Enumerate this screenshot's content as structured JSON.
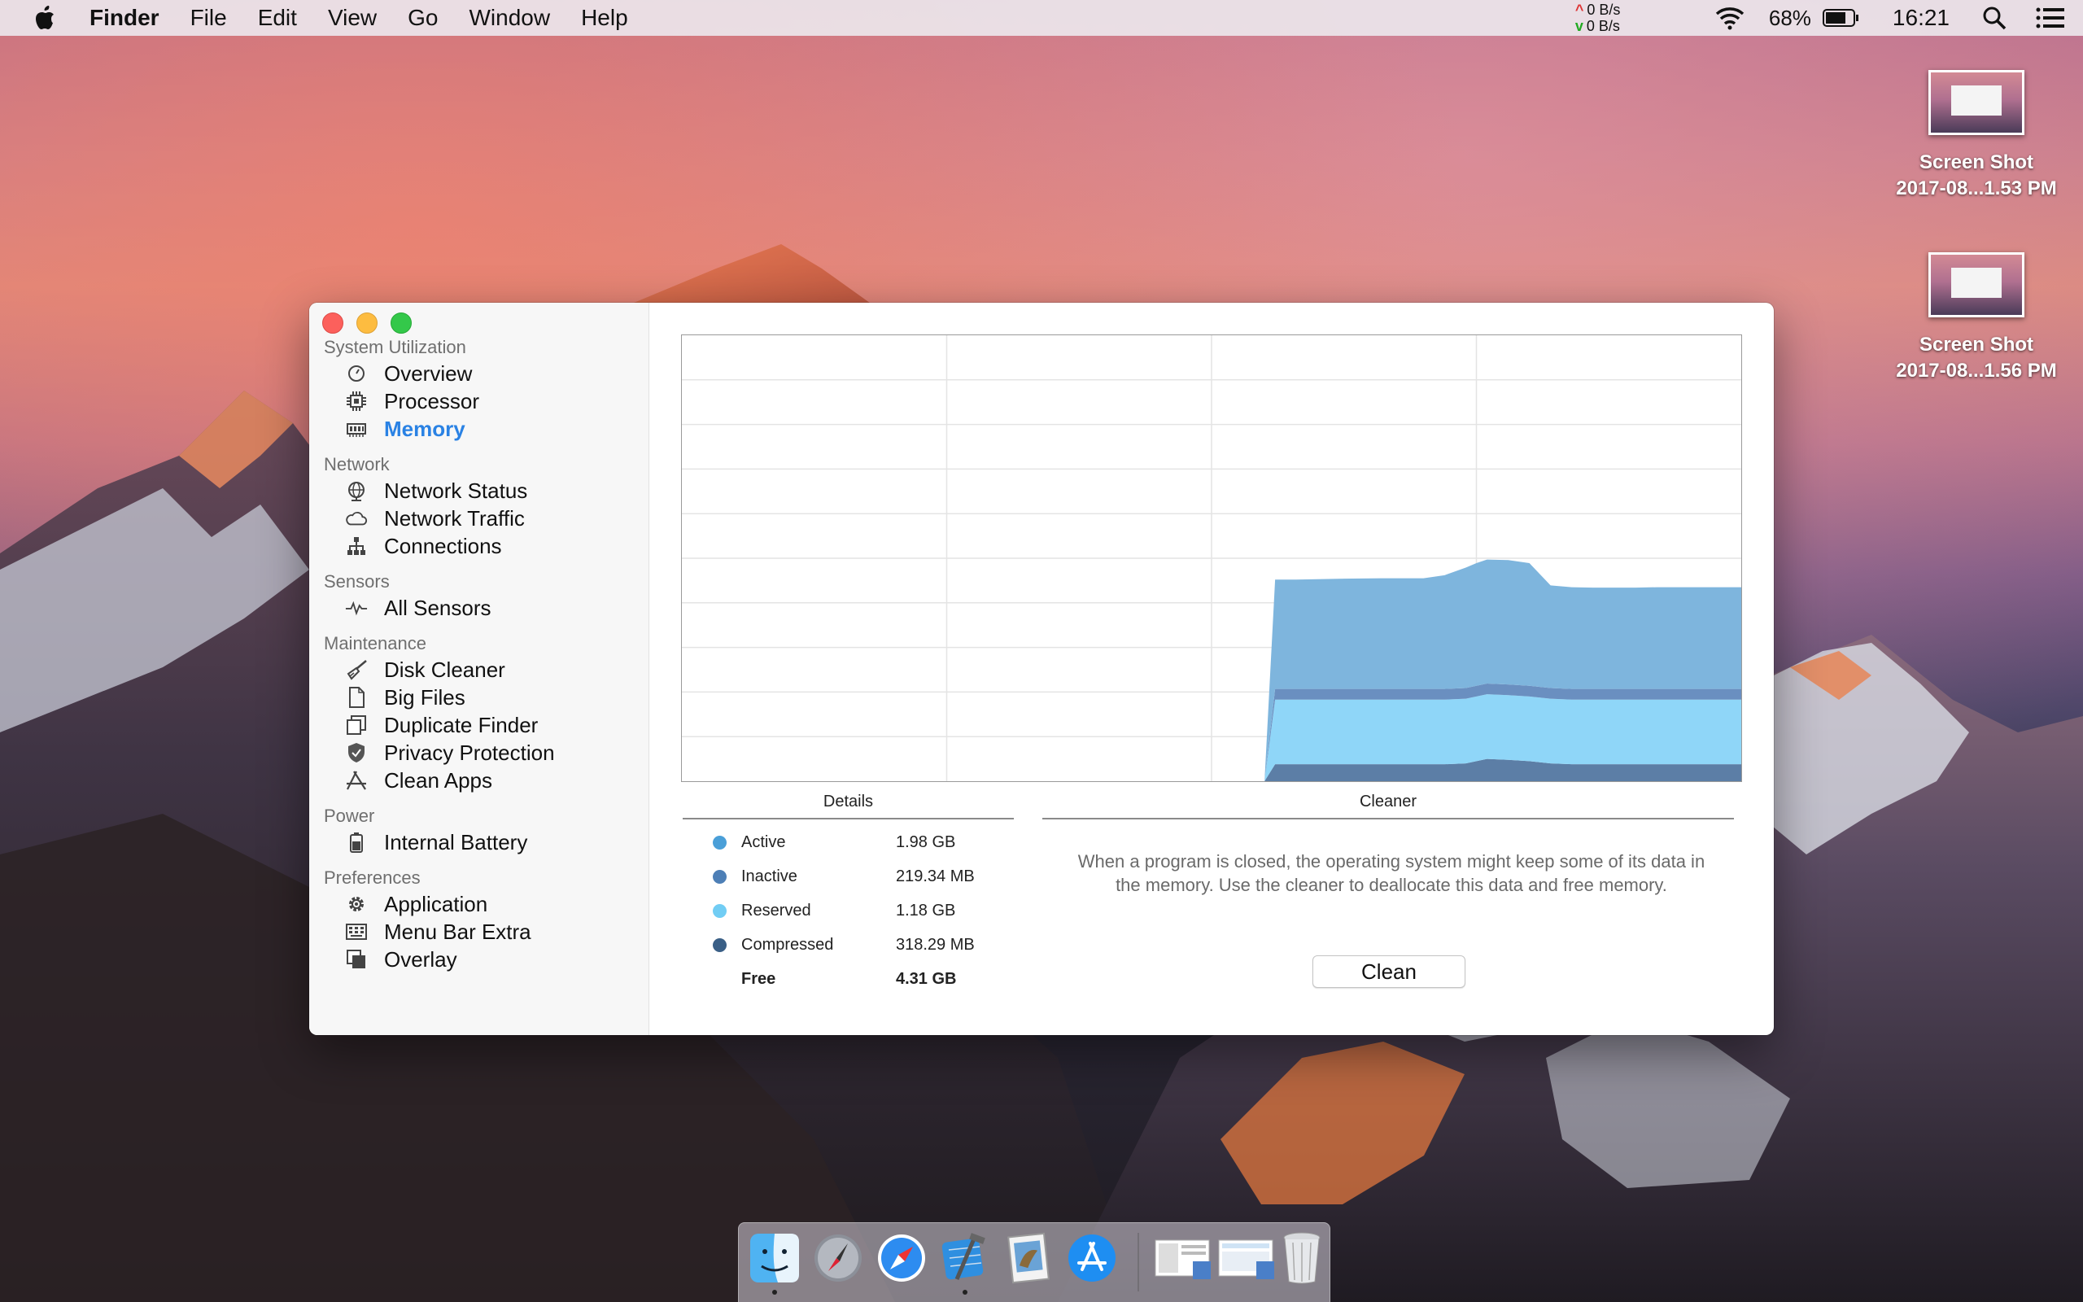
{
  "menubar": {
    "app_name": "Finder",
    "items": [
      "File",
      "Edit",
      "View",
      "Go",
      "Window",
      "Help"
    ],
    "net_up": "0 B/s",
    "net_down": "0 B/s",
    "battery_percent": "68%",
    "clock": "16:21",
    "icons": [
      "apple-logo-icon",
      "wifi-icon",
      "battery-icon",
      "search-icon",
      "list-icon"
    ]
  },
  "desktop_icons": [
    {
      "line1": "Screen Shot",
      "line2": "2017-08...1.53 PM"
    },
    {
      "line1": "Screen Shot",
      "line2": "2017-08...1.56 PM"
    }
  ],
  "sidebar": {
    "groups": [
      {
        "title": "System Utilization",
        "items": [
          {
            "label": "Overview",
            "icon": "gauge-icon"
          },
          {
            "label": "Processor",
            "icon": "cpu-icon"
          },
          {
            "label": "Memory",
            "icon": "memory-icon",
            "active": true
          }
        ]
      },
      {
        "title": "Network",
        "items": [
          {
            "label": "Network Status",
            "icon": "globe-icon"
          },
          {
            "label": "Network Traffic",
            "icon": "cloud-icon"
          },
          {
            "label": "Connections",
            "icon": "hierarchy-icon"
          }
        ]
      },
      {
        "title": "Sensors",
        "items": [
          {
            "label": "All Sensors",
            "icon": "pulse-icon"
          }
        ]
      },
      {
        "title": "Maintenance",
        "items": [
          {
            "label": "Disk Cleaner",
            "icon": "broom-icon"
          },
          {
            "label": "Big Files",
            "icon": "document-icon"
          },
          {
            "label": "Duplicate Finder",
            "icon": "copies-icon"
          },
          {
            "label": "Privacy Protection",
            "icon": "shield-icon"
          },
          {
            "label": "Clean Apps",
            "icon": "app-store-icon"
          }
        ]
      },
      {
        "title": "Power",
        "items": [
          {
            "label": "Internal Battery",
            "icon": "battery-icon"
          }
        ]
      },
      {
        "title": "Preferences",
        "items": [
          {
            "label": "Application",
            "icon": "gear-icon"
          },
          {
            "label": "Menu Bar Extra",
            "icon": "keyboard-icon"
          },
          {
            "label": "Overlay",
            "icon": "overlay-icon"
          }
        ]
      }
    ]
  },
  "chart_data": {
    "type": "area",
    "title": "",
    "xlabel": "",
    "ylabel": "",
    "grid": true,
    "x": [
      0,
      10,
      20,
      30,
      40,
      50,
      54,
      55,
      56,
      58,
      62,
      66,
      70,
      72,
      74,
      75,
      76,
      78,
      80,
      82,
      84,
      86,
      88,
      90,
      92,
      94,
      96,
      98,
      100
    ],
    "ylim": [
      0,
      10
    ],
    "series": [
      {
        "values": [
          0,
          0,
          0,
          0,
          0,
          0,
          0,
          0,
          2.45,
          2.45,
          2.47,
          2.48,
          2.48,
          2.55,
          2.7,
          2.75,
          2.78,
          2.79,
          2.75,
          2.3,
          2.28,
          2.27,
          2.27,
          2.27,
          2.28,
          2.28,
          2.28,
          2.28,
          2.28
        ],
        "color": "#7eb5dd"
      },
      {
        "values": [
          0,
          0,
          0,
          0,
          0,
          0,
          0,
          0,
          0.24,
          0.24,
          0.24,
          0.24,
          0.24,
          0.24,
          0.24,
          0.24,
          0.24,
          0.24,
          0.24,
          0.24,
          0.24,
          0.24,
          0.24,
          0.24,
          0.24,
          0.24,
          0.24,
          0.24,
          0.24
        ],
        "color": "#6a8fc0"
      },
      {
        "values": [
          0,
          0,
          0,
          0,
          0,
          0,
          0,
          0,
          1.45,
          1.45,
          1.45,
          1.45,
          1.45,
          1.45,
          1.45,
          1.45,
          1.45,
          1.45,
          1.45,
          1.45,
          1.45,
          1.45,
          1.45,
          1.45,
          1.45,
          1.45,
          1.45,
          1.45,
          1.45
        ],
        "color": "#8fd6f8"
      },
      {
        "values": [
          0,
          0,
          0,
          0,
          0,
          0,
          0,
          0,
          0.38,
          0.38,
          0.38,
          0.38,
          0.38,
          0.38,
          0.4,
          0.45,
          0.5,
          0.48,
          0.45,
          0.4,
          0.38,
          0.38,
          0.38,
          0.38,
          0.38,
          0.38,
          0.38,
          0.38,
          0.38
        ],
        "color": "#5c7ea6"
      }
    ]
  },
  "details": {
    "header": "Details",
    "rows": [
      {
        "label": "Active",
        "value": "1.98 GB",
        "color": "#4a9fd8"
      },
      {
        "label": "Inactive",
        "value": "219.34 MB",
        "color": "#4d7fb6"
      },
      {
        "label": "Reserved",
        "value": "1.18 GB",
        "color": "#71cdf4"
      },
      {
        "label": "Compressed",
        "value": "318.29 MB",
        "color": "#3a5f86"
      }
    ],
    "free_label": "Free",
    "free_value": "4.31 GB"
  },
  "cleaner": {
    "header": "Cleaner",
    "description": "When a program is closed, the operating system might keep some of its data in the memory. Use the cleaner to deallocate this data and  free memory.",
    "button_label": "Clean"
  },
  "dock": {
    "items": [
      "finder-icon",
      "launchpad-icon",
      "safari-icon",
      "xcode-icon",
      "preview-icon",
      "app-store-icon"
    ],
    "recent": [
      "screenshot-stack-icon",
      "screenshot-stack-icon",
      "trash-icon"
    ]
  }
}
